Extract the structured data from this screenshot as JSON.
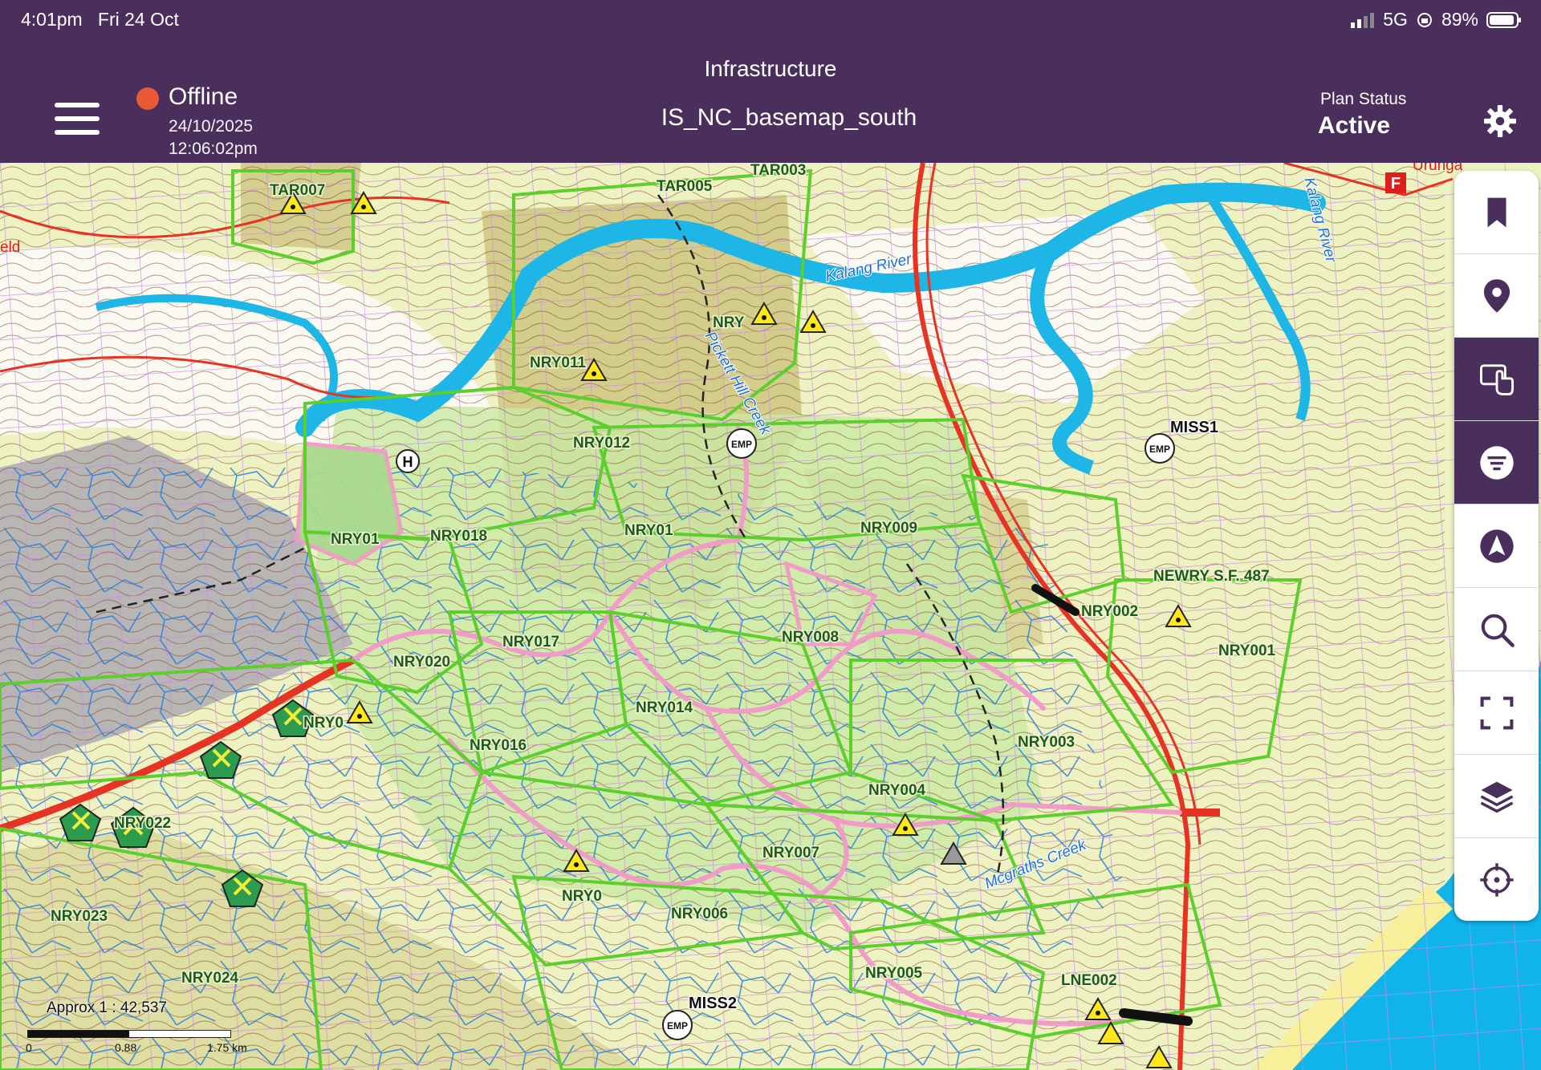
{
  "status_bar": {
    "time": "4:01pm",
    "date": "Fri 24 Oct",
    "network": "5G",
    "battery": "89%"
  },
  "header": {
    "app_title": "Infrastructure",
    "map_name": "IS_NC_basemap_south",
    "connection_status": "Offline",
    "sync_date": "24/10/2025",
    "sync_time": "12:06:02pm",
    "plan_status_label": "Plan Status",
    "plan_status_value": "Active",
    "icons": {
      "menu": "hamburger-icon",
      "settings": "gear-icon"
    }
  },
  "colors": {
    "header_bg": "#4a2f5d",
    "offline_dot": "#ea5a36",
    "compartment_boundary": "#5ccf2c",
    "trail_pink": "#f19bc8",
    "road_red": "#e63323",
    "water_blue": "#1eb6e6",
    "ocean": "#11b4ea",
    "contour": "#7a3b1e",
    "grid": "#c98ae6"
  },
  "toolbar": {
    "tools": [
      {
        "name": "bookmark-icon",
        "active": false
      },
      {
        "name": "location-pin-icon",
        "active": false
      },
      {
        "name": "touch-select-icon",
        "active": true
      },
      {
        "name": "filter-icon",
        "active": true
      },
      {
        "name": "navigation-arrow-icon",
        "active": false
      },
      {
        "name": "search-icon",
        "active": false
      },
      {
        "name": "fullscreen-icon",
        "active": false
      },
      {
        "name": "layers-icon",
        "active": false
      },
      {
        "name": "crosshair-icon",
        "active": false
      }
    ]
  },
  "map": {
    "labels": {
      "tar007": "TAR007",
      "tar005": "TAR005",
      "tar003": "TAR003",
      "nry_top": "NRY",
      "nry011": "NRY011",
      "nry012": "NRY012",
      "nry018": "NRY018",
      "nry01_a": "NRY01",
      "nry01_b": "NRY01",
      "nry009": "NRY009",
      "newry_sf": "NEWRY S.F. 487",
      "nry002": "NRY002",
      "nry001": "NRY001",
      "nry017": "NRY017",
      "nry008": "NRY008",
      "nry020": "NRY020",
      "nry014": "NRY014",
      "nry016": "NRY016",
      "nry0_b": "NRY0",
      "nry003": "NRY003",
      "nry004": "NRY004",
      "nry007": "NRY007",
      "nry022": "NRY022",
      "nry023": "NRY023",
      "nry0_c": "NRY0",
      "nry006": "NRY006",
      "nry005": "NRY005",
      "nry024": "NRY024",
      "lne002": "LNE002",
      "miss1": "MISS1",
      "miss2": "MISS2",
      "emp": "EMP",
      "kalang_river": "Kalang River",
      "kalang_river_2": "Kalang River",
      "pickett_hill_creek": "Pickett Hill Creek",
      "mcgraths_creek": "Mcgraths Creek",
      "urunga": "Urunga",
      "field_partial": "eld"
    },
    "marker_types": [
      "warning-triangle-icon",
      "helipad-icon",
      "emp-icon",
      "fire-station-icon",
      "pentagon-marker-icon"
    ]
  },
  "scale": {
    "text": "Approx 1 : 42,537",
    "ticks": [
      "0",
      "0.88",
      "1.75 km"
    ]
  }
}
